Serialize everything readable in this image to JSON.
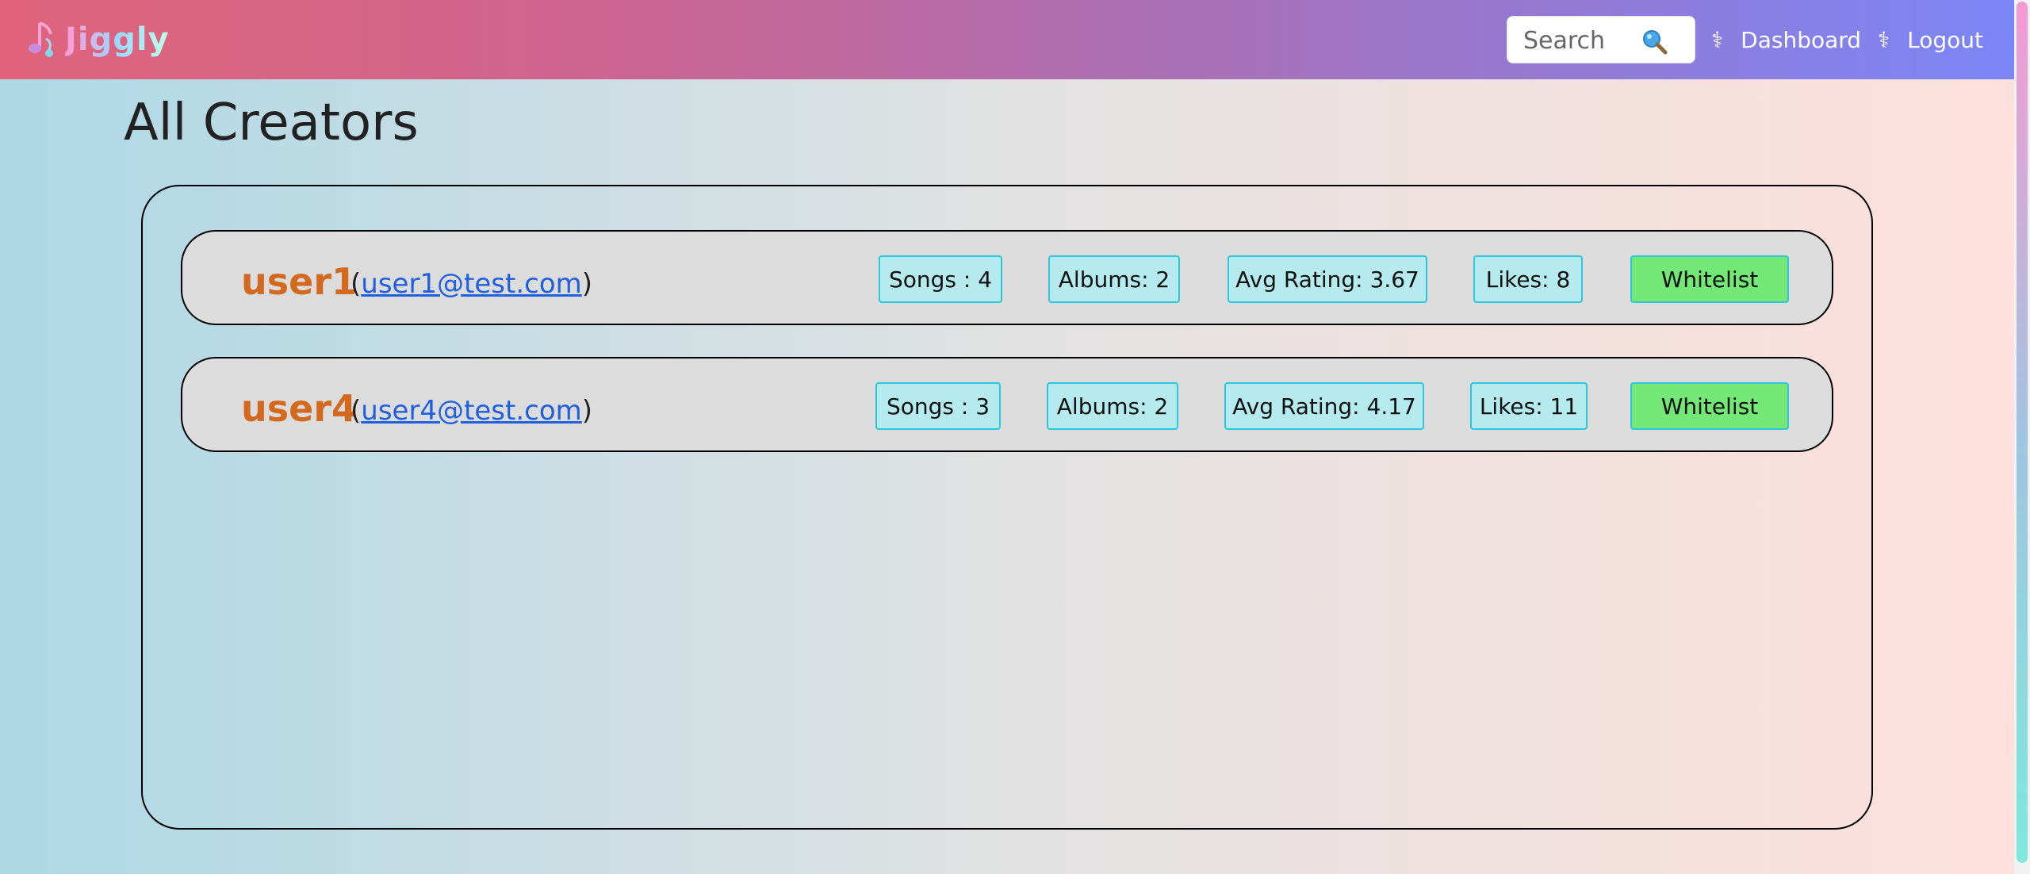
{
  "nav": {
    "brand": "Jiggly",
    "search_placeholder": "Search",
    "search_icon": "magnifier-icon",
    "nav_glyph": "⚕",
    "dashboard_label": "Dashboard",
    "logout_label": "Logout"
  },
  "page": {
    "title": "All Creators"
  },
  "creators": [
    {
      "name": "user1",
      "open_paren": "(",
      "email": "user1@test.com",
      "close_paren": ")",
      "songs": "Songs : 4",
      "albums": "Albums: 2",
      "avg_rating": "Avg Rating: 3.67",
      "likes": "Likes: 8",
      "action_label": "Whitelist"
    },
    {
      "name": "user4",
      "open_paren": "(",
      "email": "user4@test.com",
      "close_paren": ")",
      "songs": "Songs : 3",
      "albums": "Albums: 2",
      "avg_rating": "Avg Rating: 4.17",
      "likes": "Likes: 11",
      "action_label": "Whitelist"
    }
  ],
  "colors": {
    "creator_name": "#d2691e",
    "stat_bg": "#b5ebef",
    "stat_border": "#2ec6dc",
    "whitelist_bg": "#73e877",
    "link": "#1f5fe0"
  }
}
